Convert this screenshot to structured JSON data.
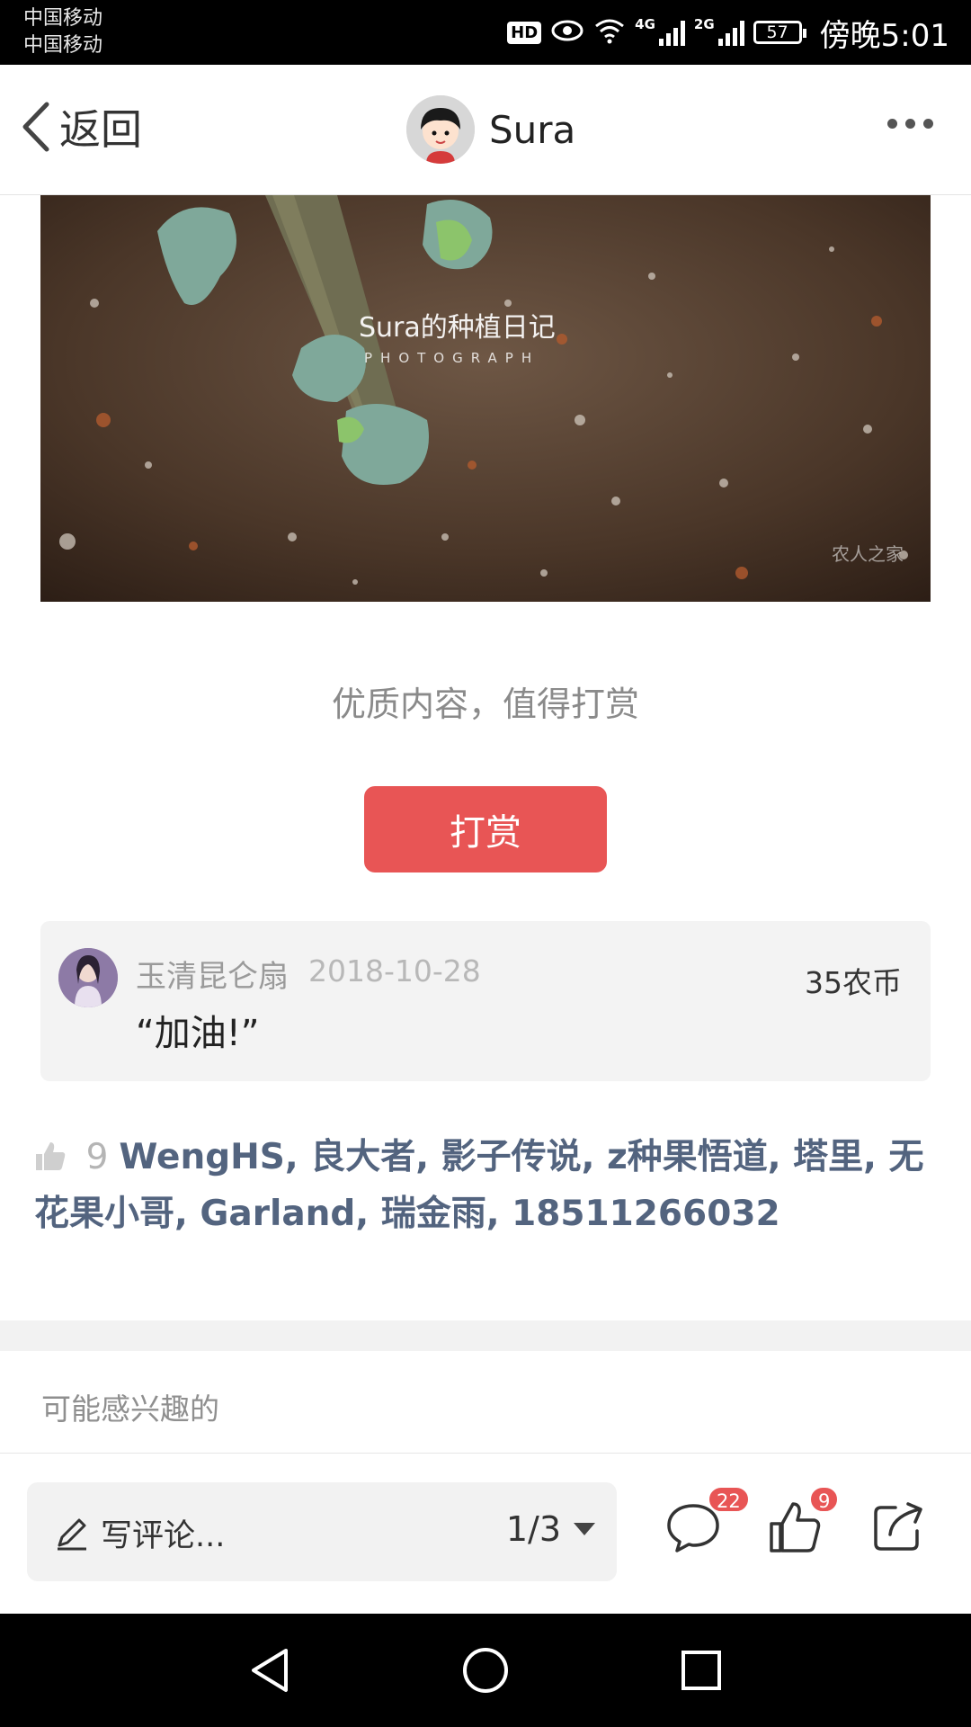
{
  "status_bar": {
    "carrier_1": "中国移动",
    "carrier_2": "中国移动",
    "hd": "HD",
    "net_1": "4G",
    "net_2": "2G",
    "battery": "57",
    "time": "傍晚5:01"
  },
  "header": {
    "back_label": "返回",
    "username": "Sura"
  },
  "photo": {
    "title": "Sura的种植日记",
    "subtitle": "PHOTOGRAPH",
    "watermark": "农人之家"
  },
  "tip": {
    "prompt": "优质内容，值得打赏",
    "button_label": "打赏"
  },
  "reward": {
    "user": "玉清昆仑扇",
    "date": "2018-10-28",
    "amount": "35农币",
    "message": "“加油!”"
  },
  "likes": {
    "count": "9",
    "users": "WengHS, 良大者, 影子传说, z种果悟道, 塔里, 无花果小哥, Garland, 瑞金雨, 18511266032"
  },
  "section": {
    "related_title": "可能感兴趣的"
  },
  "bottom_bar": {
    "comment_placeholder": "写评论...",
    "page_indicator": "1/3",
    "comment_badge": "22",
    "like_badge": "9"
  },
  "icons": {
    "back": "chevron-left-icon",
    "more": "more-dots-icon",
    "comment": "speech-bubble-icon",
    "like": "thumbs-up-icon",
    "share": "share-icon",
    "pencil": "pencil-icon"
  },
  "colors": {
    "accent": "#e85555",
    "link": "#53647f"
  }
}
